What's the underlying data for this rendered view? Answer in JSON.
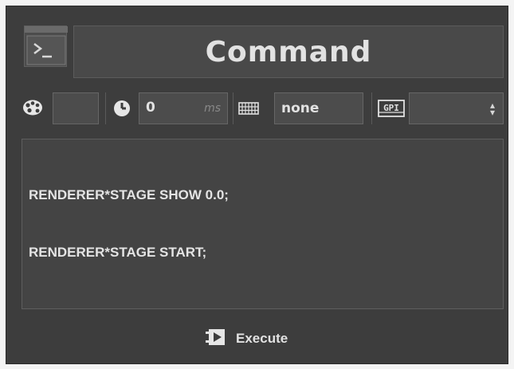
{
  "header": {
    "title": "Command",
    "icon": "terminal-icon"
  },
  "toolbar": {
    "color": {
      "icon": "palette-icon",
      "value": ""
    },
    "delay": {
      "icon": "clock-icon",
      "value": "0",
      "unit": "ms"
    },
    "shortcut": {
      "icon": "keyboard-icon",
      "value": "none"
    },
    "gpi": {
      "icon": "gpi-icon",
      "label": "GPI",
      "value": ""
    }
  },
  "command": {
    "lines": [
      "RENDERER*STAGE SHOW 0.0;",
      "RENDERER*STAGE START;"
    ]
  },
  "execute": {
    "label": "Execute",
    "icon": "execute-icon"
  },
  "colors": {
    "panel_bg": "#3d3d3d",
    "field_bg": "#4c4c4c",
    "text": "#e2e2e2",
    "muted": "#888888"
  }
}
